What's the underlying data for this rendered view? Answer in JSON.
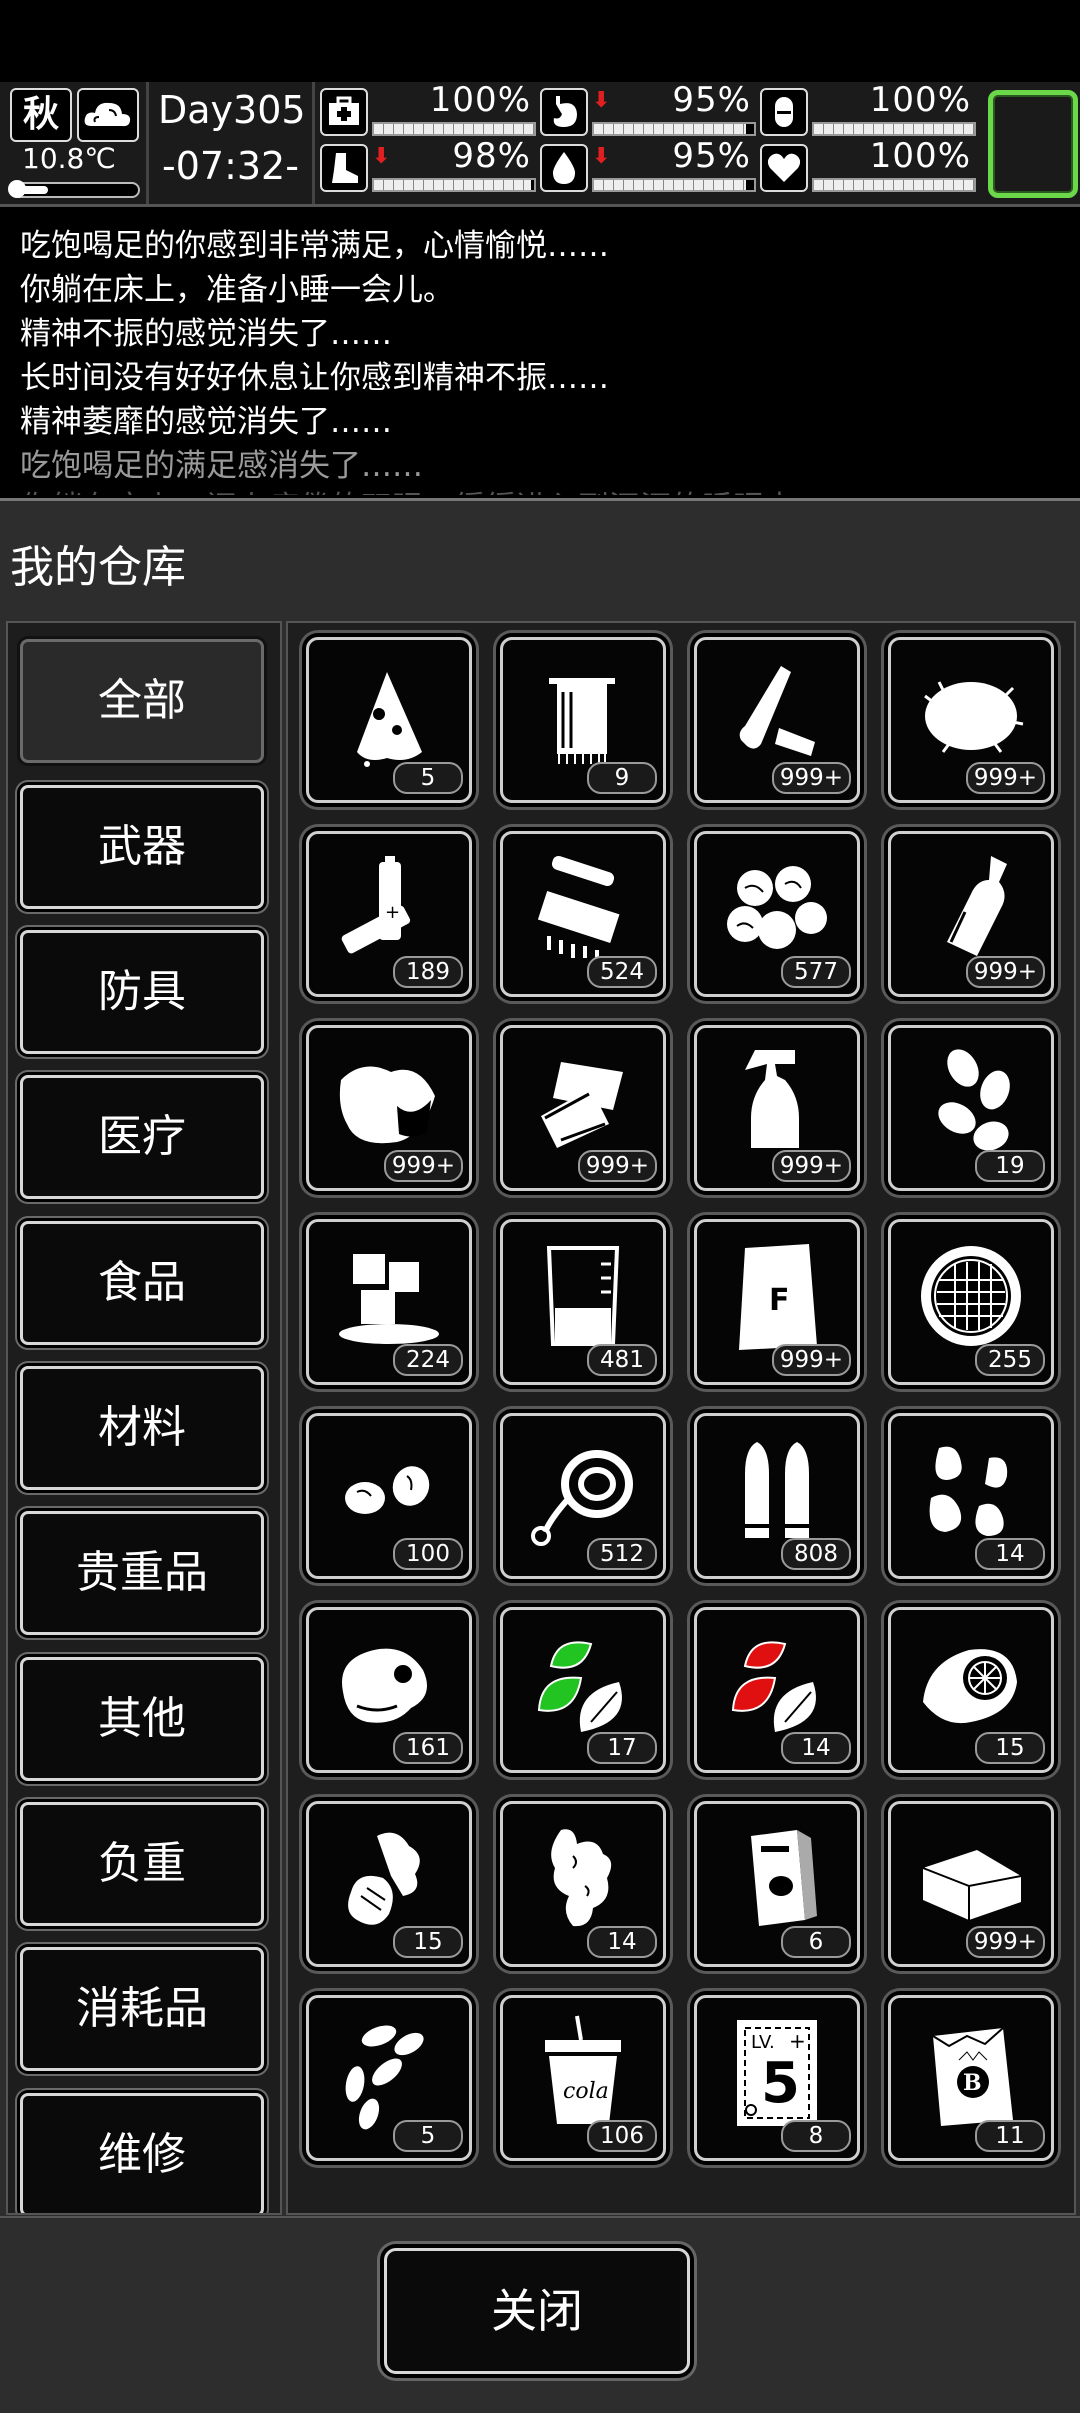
{
  "status": {
    "season": "秋",
    "temperature": "10.8℃",
    "temperature_level": 0.25,
    "day": "Day305",
    "time": "-07:32-",
    "stats": [
      {
        "name": "health",
        "icon": "first-aid-icon",
        "value": "100%",
        "level": 1.0,
        "falling": false
      },
      {
        "name": "hunger",
        "icon": "stomach-icon",
        "value": "95%",
        "level": 0.95,
        "falling": true
      },
      {
        "name": "sanity",
        "icon": "capsule-icon",
        "value": "100%",
        "level": 1.0,
        "falling": false
      },
      {
        "name": "stamina",
        "icon": "boot-icon",
        "value": "98%",
        "level": 0.98,
        "falling": true
      },
      {
        "name": "thirst",
        "icon": "water-drop-icon",
        "value": "95%",
        "level": 0.95,
        "falling": true
      },
      {
        "name": "mood",
        "icon": "heart-icon",
        "value": "100%",
        "level": 1.0,
        "falling": false
      }
    ],
    "accent_color": "#6bd84a",
    "falling_color": "#e02020"
  },
  "log": [
    "吃饱喝足的你感到非常满足，心情愉悦……",
    "你躺在床上，准备小睡一会儿。",
    "精神不振的感觉消失了……",
    "长时间没有好好休息让你感到精神不振……",
    "精神萎靡的感觉消失了……",
    "吃饱喝足的满足感消失了……",
    "你躺在床上，闭上疲倦的双眼，缓缓进入到深沉的睡眠中。"
  ],
  "warehouse": {
    "title": "我的仓库",
    "tabs": [
      "全部",
      "武器",
      "防具",
      "医疗",
      "食品",
      "材料",
      "贵重品",
      "其他",
      "负重",
      "消耗品",
      "维修"
    ],
    "active_tab": "全部",
    "items": [
      {
        "icon": "cloth-scrap-icon",
        "count": "5"
      },
      {
        "icon": "towel-icon",
        "count": "9"
      },
      {
        "icon": "plastic-bottles-icon",
        "count": "999+"
      },
      {
        "icon": "cotton-fiber-icon",
        "count": "999+"
      },
      {
        "icon": "batteries-icon",
        "count": "189"
      },
      {
        "icon": "electronic-parts-icon",
        "count": "524"
      },
      {
        "icon": "potatoes-icon",
        "count": "577"
      },
      {
        "icon": "glass-bottle-icon",
        "count": "999+"
      },
      {
        "icon": "leather-icon",
        "count": "999+"
      },
      {
        "icon": "paper-scraps-icon",
        "count": "999+"
      },
      {
        "icon": "spray-bottle-icon",
        "count": "999+"
      },
      {
        "icon": "seeds-icon",
        "count": "19"
      },
      {
        "icon": "ice-cubes-icon",
        "count": "224"
      },
      {
        "icon": "beaker-icon",
        "count": "481"
      },
      {
        "icon": "fertilizer-bag-icon",
        "count": "999+"
      },
      {
        "icon": "filter-mesh-icon",
        "count": "255"
      },
      {
        "icon": "nuts-icon",
        "count": "100"
      },
      {
        "icon": "rope-icon",
        "count": "512"
      },
      {
        "icon": "bullets-icon",
        "count": "808"
      },
      {
        "icon": "peanuts-icon",
        "count": "14"
      },
      {
        "icon": "meat-icon",
        "count": "161"
      },
      {
        "icon": "green-herb-icon",
        "count": "17"
      },
      {
        "icon": "red-herb-icon",
        "count": "14"
      },
      {
        "icon": "turbine-part-icon",
        "count": "15"
      },
      {
        "icon": "vegetable-icon",
        "count": "15"
      },
      {
        "icon": "ginger-root-icon",
        "count": "14"
      },
      {
        "icon": "cereal-box-icon",
        "count": "6"
      },
      {
        "icon": "fabric-icon",
        "count": "999+"
      },
      {
        "icon": "sunflower-seeds-icon",
        "count": "5"
      },
      {
        "icon": "cola-cup-icon",
        "count": "106"
      },
      {
        "icon": "level-card-icon",
        "count": "8"
      },
      {
        "icon": "badge-bag-icon",
        "count": "11"
      }
    ],
    "herb_colors": {
      "green": "#22c422",
      "red": "#e01010"
    },
    "card_text": {
      "lv": "LV.",
      "plus": "+",
      "number": "5"
    },
    "cola_text": "cola",
    "bag_letter": "F",
    "badge_letter": "B",
    "close_label": "关闭"
  }
}
